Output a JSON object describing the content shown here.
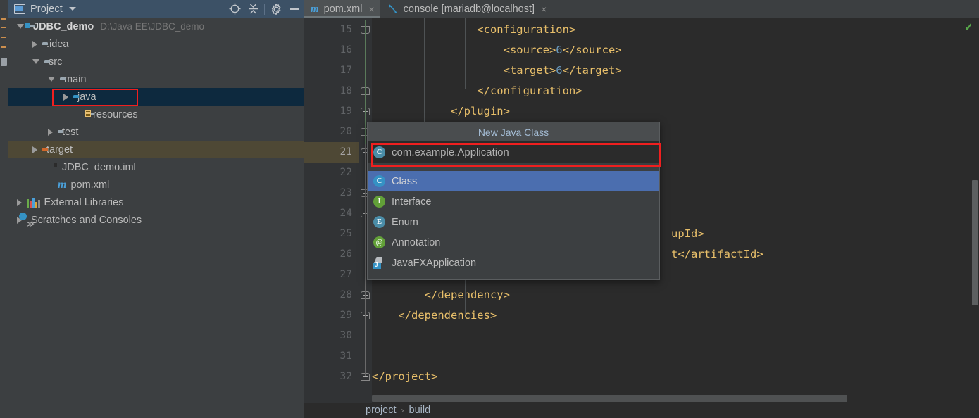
{
  "window": {
    "app": "IntelliJ IDEA",
    "accent_red": "#f01f1f",
    "accent_blue": "#3592c4",
    "selection_blue": "#4b6eaf"
  },
  "project_panel": {
    "title": "Project",
    "icons": {
      "panel": "project-view-icon",
      "dropdown": "chevron-down-icon",
      "locate": "crosshair-target-icon",
      "collapse": "collapse-all-icon",
      "settings": "gear-icon",
      "hide": "minimize-icon"
    },
    "tree": [
      {
        "label": "JDBC_demo",
        "secondary": "D:\\Java EE\\JDBC_demo",
        "depth": 0,
        "state": "expanded",
        "icon": "module-folder-icon",
        "bold": true
      },
      {
        "label": ".idea",
        "secondary": "",
        "depth": 1,
        "state": "collapsed",
        "icon": "folder-icon",
        "bold": false
      },
      {
        "label": "src",
        "secondary": "",
        "depth": 1,
        "state": "expanded",
        "icon": "folder-icon",
        "bold": false
      },
      {
        "label": "main",
        "secondary": "",
        "depth": 2,
        "state": "expanded",
        "icon": "folder-icon",
        "bold": false
      },
      {
        "label": "java",
        "secondary": "",
        "depth": 3,
        "state": "collapsed",
        "icon": "source-folder-icon",
        "bold": false,
        "selected": true,
        "annotated": true
      },
      {
        "label": "resources",
        "secondary": "",
        "depth": 4,
        "state": "leaf",
        "icon": "resources-folder-icon",
        "bold": false
      },
      {
        "label": "test",
        "secondary": "",
        "depth": 2,
        "state": "collapsed",
        "icon": "folder-icon",
        "bold": false
      },
      {
        "label": "target",
        "secondary": "",
        "depth": 1,
        "state": "collapsed",
        "icon": "excluded-folder-icon",
        "bold": false,
        "highlighted": true
      },
      {
        "label": "JDBC_demo.iml",
        "secondary": "",
        "depth": 2,
        "state": "leaf",
        "icon": "iml-file-icon",
        "bold": false
      },
      {
        "label": "pom.xml",
        "secondary": "",
        "depth": 2,
        "state": "leaf",
        "icon": "maven-file-icon",
        "bold": false
      },
      {
        "label": "External Libraries",
        "secondary": "",
        "depth": 0,
        "state": "collapsed",
        "icon": "libraries-icon",
        "bold": false
      },
      {
        "label": "Scratches and Consoles",
        "secondary": "",
        "depth": 0,
        "state": "collapsed",
        "icon": "scratches-icon",
        "bold": false
      }
    ]
  },
  "editor": {
    "tabs": [
      {
        "label": "pom.xml",
        "icon": "maven-file-icon",
        "active": true,
        "close": "×"
      },
      {
        "label": "console [mariadb@localhost]",
        "icon": "database-console-icon",
        "active": false,
        "close": "×"
      }
    ],
    "inspection_status": "✓",
    "lines": [
      {
        "no": "15",
        "segments": [
          {
            "t": "                <configuration>",
            "c": "tk"
          }
        ],
        "fold": "down-start"
      },
      {
        "no": "16",
        "segments": [
          {
            "t": "                    <source>",
            "c": "tk"
          },
          {
            "t": "6",
            "c": "num"
          },
          {
            "t": "</source>",
            "c": "tk"
          }
        ],
        "fold": ""
      },
      {
        "no": "17",
        "segments": [
          {
            "t": "                    <target>",
            "c": "tk"
          },
          {
            "t": "6",
            "c": "num"
          },
          {
            "t": "</target>",
            "c": "tk"
          }
        ],
        "fold": ""
      },
      {
        "no": "18",
        "segments": [
          {
            "t": "                </configuration>",
            "c": "tk"
          }
        ],
        "fold": "up-end"
      },
      {
        "no": "19",
        "segments": [
          {
            "t": "            </plugin>",
            "c": "tk"
          }
        ],
        "fold": "up-end"
      },
      {
        "no": "20",
        "segments": [],
        "fold": "up-end"
      },
      {
        "no": "21",
        "segments": [],
        "fold": "up-end",
        "current": true
      },
      {
        "no": "22",
        "segments": [],
        "fold": ""
      },
      {
        "no": "23",
        "segments": [],
        "fold": "down-start"
      },
      {
        "no": "24",
        "segments": [],
        "fold": "down-start"
      },
      {
        "no": "25",
        "segments": [
          {
            "t": "upId>",
            "c": "tk"
          }
        ],
        "fold": "",
        "clipped": true
      },
      {
        "no": "26",
        "segments": [
          {
            "t": "t</artifactId>",
            "c": "tk"
          }
        ],
        "fold": "",
        "clipped": true
      },
      {
        "no": "27",
        "segments": [],
        "fold": ""
      },
      {
        "no": "28",
        "segments": [
          {
            "t": "        </dependency>",
            "c": "tk"
          }
        ],
        "fold": "up-end"
      },
      {
        "no": "29",
        "segments": [
          {
            "t": "    </dependencies>",
            "c": "tk"
          }
        ],
        "fold": "up-end"
      },
      {
        "no": "30",
        "segments": [],
        "fold": ""
      },
      {
        "no": "31",
        "segments": [],
        "fold": ""
      },
      {
        "no": "32",
        "segments": [
          {
            "t": "</project>",
            "c": "tk"
          }
        ],
        "fold": "up-end"
      }
    ],
    "breadcrumb": [
      "project",
      "build"
    ],
    "breadcrumb_separator": "›"
  },
  "popup": {
    "title": "New Java Class",
    "input_value": "com.example.Application",
    "input_icon": "class-icon",
    "annotated": true,
    "items": [
      {
        "label": "Class",
        "icon": "class-icon",
        "icon_style": "blue",
        "glyph": "C",
        "selected": true
      },
      {
        "label": "Interface",
        "icon": "interface-icon",
        "icon_style": "green",
        "glyph": "I",
        "selected": false
      },
      {
        "label": "Enum",
        "icon": "enum-icon",
        "icon_style": "teal",
        "glyph": "E",
        "selected": false
      },
      {
        "label": "Annotation",
        "icon": "annotation-icon",
        "icon_style": "green",
        "glyph": "@",
        "selected": false
      },
      {
        "label": "JavaFXApplication",
        "icon": "javafx-application-icon",
        "icon_style": "fx",
        "glyph": "",
        "selected": false
      }
    ]
  }
}
